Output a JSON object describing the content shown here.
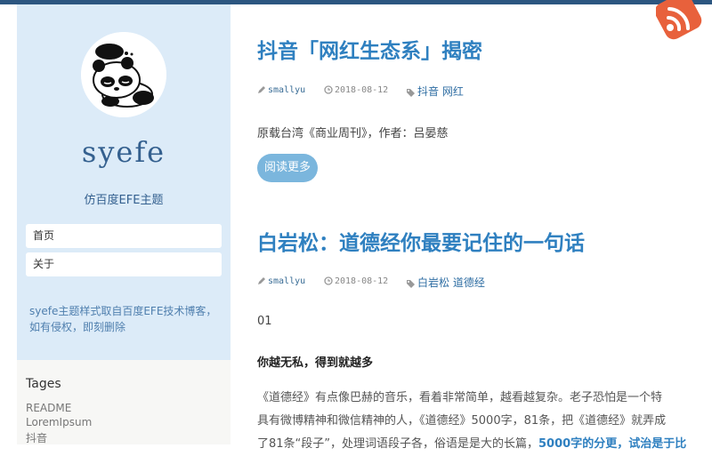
{
  "sidebar": {
    "site_title": "syefe",
    "subtitle": "仿百度EFE主题",
    "nav": [
      {
        "label": "首页"
      },
      {
        "label": "关于"
      }
    ],
    "notice": "syefe主题样式取自百度EFE技术博客，如有侵权，即刻删除",
    "tags_title": "Tages",
    "tags": [
      "README",
      "LoremIpsum",
      "抖音"
    ]
  },
  "posts": [
    {
      "title": "抖音「网红生态系」揭密",
      "author": "smallyu",
      "date": "2018-08-12",
      "tags": "抖音 网红",
      "excerpt": "原载台湾《商业周刊》，作者：吕晏慈",
      "read_more": "阅读更多"
    },
    {
      "title": "白岩松：道德经你最要记住的一句话",
      "author": "smallyu",
      "date": "2018-08-12",
      "tags": "白岩松 道德经",
      "p1": "01",
      "p2": "你越无私，得到就越多",
      "p3_line1": "《道德经》有点像巴赫的音乐，看着非常简单，越看越复杂。老子恐怕是一个特",
      "p3_line2": "具有微博精神和微信精神的人，《道德经》5000字，81条，把《道德经》就弄成",
      "p3_line3_a": "了81条“段子”，处理词语段子各，俗语是是大的长篇，",
      "p3_line3_b": "5000字的分更，试治是于比"
    }
  ],
  "colors": {
    "accent": "#2f80c0",
    "topbar": "#2c5680",
    "sidebar_bg": "#dcebf8",
    "rss": "#e8613c"
  }
}
